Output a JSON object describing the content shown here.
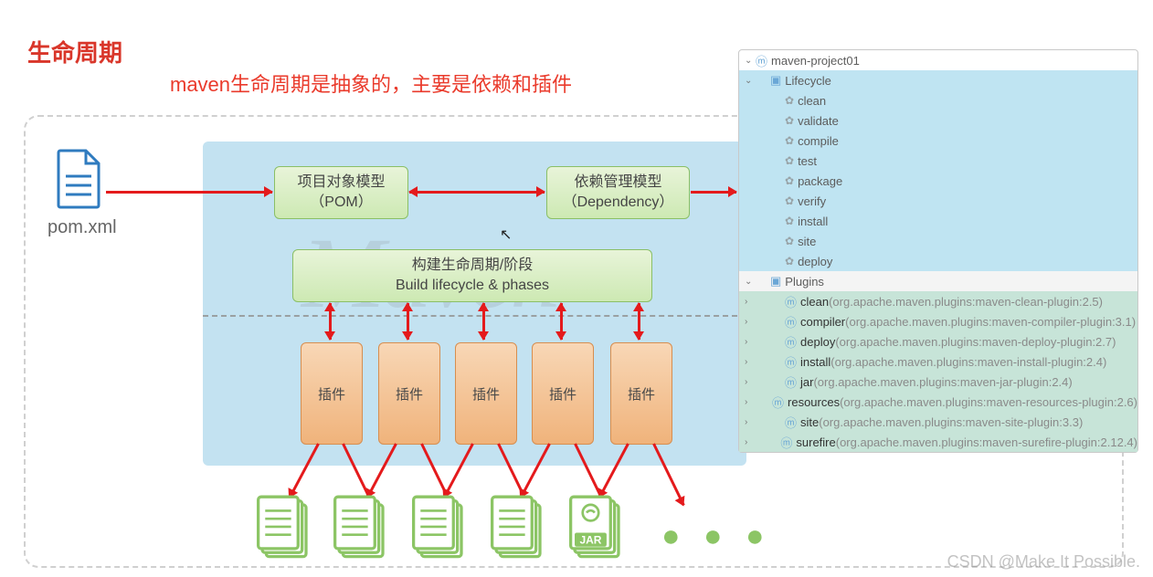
{
  "title": "生命周期",
  "subtitle": "maven生命周期是抽象的，主要是依赖和插件",
  "watermark_text": "Maven",
  "pom_file_label": "pom.xml",
  "pom_model": {
    "l1": "项目对象模型",
    "l2": "（POM）"
  },
  "dep_model": {
    "l1": "依赖管理模型",
    "l2": "（Dependency）"
  },
  "phases": {
    "l1": "构建生命周期/阶段",
    "l2": "Build lifecycle & phases"
  },
  "plugin_label": "插件",
  "jar_label": "JAR",
  "dots": "● ● ●",
  "footer_watermark": "CSDN @Make It Possible.",
  "tree": {
    "project": "maven-project01",
    "lifecycle_label": "Lifecycle",
    "lifecycle_items": [
      "clean",
      "validate",
      "compile",
      "test",
      "package",
      "verify",
      "install",
      "site",
      "deploy"
    ],
    "plugins_label": "Plugins",
    "plugins": [
      {
        "name": "clean",
        "detail": "(org.apache.maven.plugins:maven-clean-plugin:2.5)"
      },
      {
        "name": "compiler",
        "detail": "(org.apache.maven.plugins:maven-compiler-plugin:3.1)"
      },
      {
        "name": "deploy",
        "detail": "(org.apache.maven.plugins:maven-deploy-plugin:2.7)"
      },
      {
        "name": "install",
        "detail": "(org.apache.maven.plugins:maven-install-plugin:2.4)"
      },
      {
        "name": "jar",
        "detail": "(org.apache.maven.plugins:maven-jar-plugin:2.4)"
      },
      {
        "name": "resources",
        "detail": "(org.apache.maven.plugins:maven-resources-plugin:2.6)"
      },
      {
        "name": "site",
        "detail": "(org.apache.maven.plugins:maven-site-plugin:3.3)"
      },
      {
        "name": "surefire",
        "detail": "(org.apache.maven.plugins:maven-surefire-plugin:2.12.4)"
      }
    ]
  }
}
